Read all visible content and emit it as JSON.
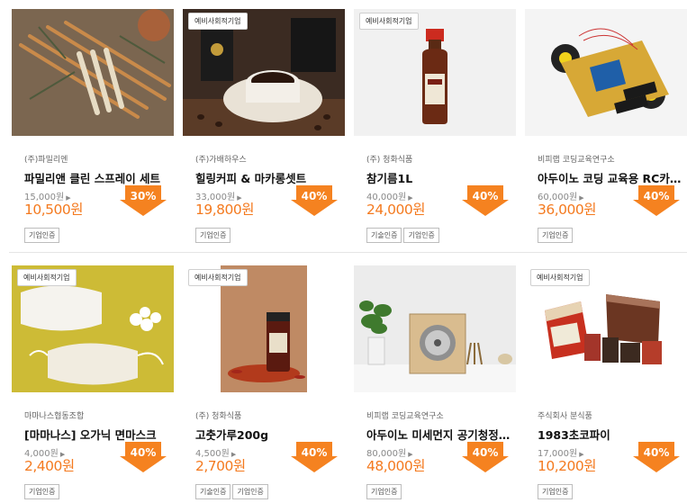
{
  "accent_color": "#f47a1f",
  "discount_color": "#f58220",
  "products": [
    {
      "badge": "",
      "seller": "(주)파밀리엔",
      "name": "파밀리앤 클린 스프레이 세트",
      "original_price": "15,000원",
      "sale_price": "10,500원",
      "discount": "30%",
      "tags": [
        "기업인증"
      ],
      "image": "cinnamon-sticks-spray-photo"
    },
    {
      "badge": "예비사회적기업",
      "seller": "(주)가배하우스",
      "name": "힐링커피 & 마카롱셋트",
      "original_price": "33,000원",
      "sale_price": "19,800원",
      "discount": "40%",
      "tags": [
        "기업인증"
      ],
      "image": "coffee-cup-photo"
    },
    {
      "badge": "예비사회적기업",
      "seller": "(주) 청화식품",
      "name": "참기름1L",
      "original_price": "40,000원",
      "sale_price": "24,000원",
      "discount": "40%",
      "tags": [
        "기술인증",
        "기업인증"
      ],
      "image": "sesame-oil-bottle-photo"
    },
    {
      "badge": "",
      "seller": "비피랩 코딩교육연구소",
      "name": "아두이노 코딩 교육용 RC카…",
      "original_price": "60,000원",
      "sale_price": "36,000원",
      "discount": "40%",
      "tags": [
        "기업인증"
      ],
      "image": "rc-car-kit-photo"
    },
    {
      "badge": "예비사회적기업",
      "seller": "마마나스협동조합",
      "name": "[마마나스] 오가닉 면마스크",
      "original_price": "4,000원",
      "sale_price": "2,400원",
      "discount": "40%",
      "tags": [
        "기업인증"
      ],
      "image": "cotton-mask-photo"
    },
    {
      "badge": "예비사회적기업",
      "seller": "(주) 청화식품",
      "name": "고춧가루200g",
      "original_price": "4,500원",
      "sale_price": "2,700원",
      "discount": "40%",
      "tags": [
        "기술인증",
        "기업인증"
      ],
      "image": "chili-powder-jar-photo"
    },
    {
      "badge": "",
      "seller": "비피랩 코딩교육연구소",
      "name": "아두이노 미세먼지 공기청정…",
      "original_price": "80,000원",
      "sale_price": "48,000원",
      "discount": "40%",
      "tags": [
        "기업인증"
      ],
      "image": "air-purifier-kit-photo"
    },
    {
      "badge": "예비사회적기업",
      "seller": "주식회사 분식품",
      "name": "1983초코파이",
      "original_price": "17,000원",
      "sale_price": "10,200원",
      "discount": "40%",
      "tags": [
        "기업인증"
      ],
      "image": "choco-pie-box-photo"
    }
  ]
}
